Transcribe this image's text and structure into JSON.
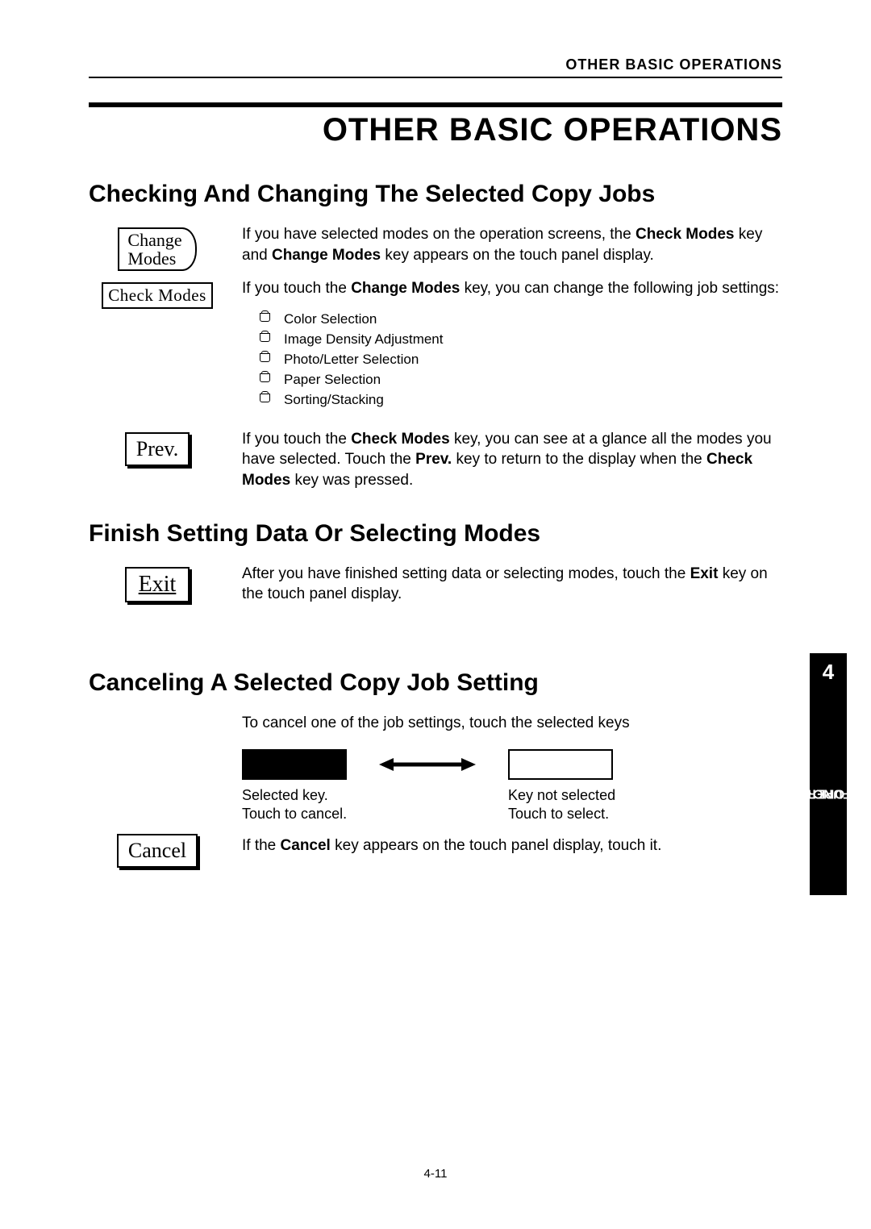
{
  "running_header": "OTHER BASIC OPERATIONS",
  "title": "OTHER BASIC OPERATIONS",
  "section1": {
    "heading": "Checking And Changing The Selected Copy Jobs",
    "btn_change_modes_l1": "Change",
    "btn_change_modes_l2": "Modes",
    "btn_check_modes": "Check Modes",
    "para1_pre": "If you have selected modes on the operation screens, the ",
    "para1_b1": "Check Modes",
    "para1_mid": " key  and ",
    "para1_b2": "Change Modes",
    "para1_post": " key appears on the touch panel display.",
    "para2_pre": "If you touch the ",
    "para2_b1": "Change Modes",
    "para2_post": " key,  you can change the following job settings:",
    "checklist": [
      "Color Selection",
      "Image Density Adjustment",
      "Photo/Letter Selection",
      "Paper Selection",
      "Sorting/Stacking"
    ],
    "btn_prev": "Prev.",
    "para3_pre": "If you touch the ",
    "para3_b1": "Check Modes",
    "para3_mid1": " key, you can see at a glance all the modes you have selected.  Touch the ",
    "para3_b2": "Prev.",
    "para3_mid2": " key to return to the display when the ",
    "para3_b3": "Check Modes",
    "para3_post": " key was pressed."
  },
  "section2": {
    "heading": "Finish Setting Data Or Selecting Modes",
    "btn_exit": "Exit",
    "para_pre": "After you have finished setting data or selecting modes, touch the ",
    "para_b1": "Exit",
    "para_post": " key on the touch panel display."
  },
  "section3": {
    "heading": "Canceling A Selected Copy Job Setting",
    "intro": "To cancel one of the job settings, touch the selected keys",
    "caption_sel_l1": "Selected key.",
    "caption_sel_l2": "Touch to cancel.",
    "caption_unsel_l1": "Key not selected",
    "caption_unsel_l2": "Touch to select.",
    "btn_cancel": "Cancel",
    "para_pre": "If the ",
    "para_b1": "Cancel",
    "para_post": " key appears on the touch panel display, touch it."
  },
  "side_tab": {
    "number": "4",
    "label_l1": "BASIC OPERATION",
    "label_l2": "AND FUNCTIONS"
  },
  "page_number": "4-11"
}
